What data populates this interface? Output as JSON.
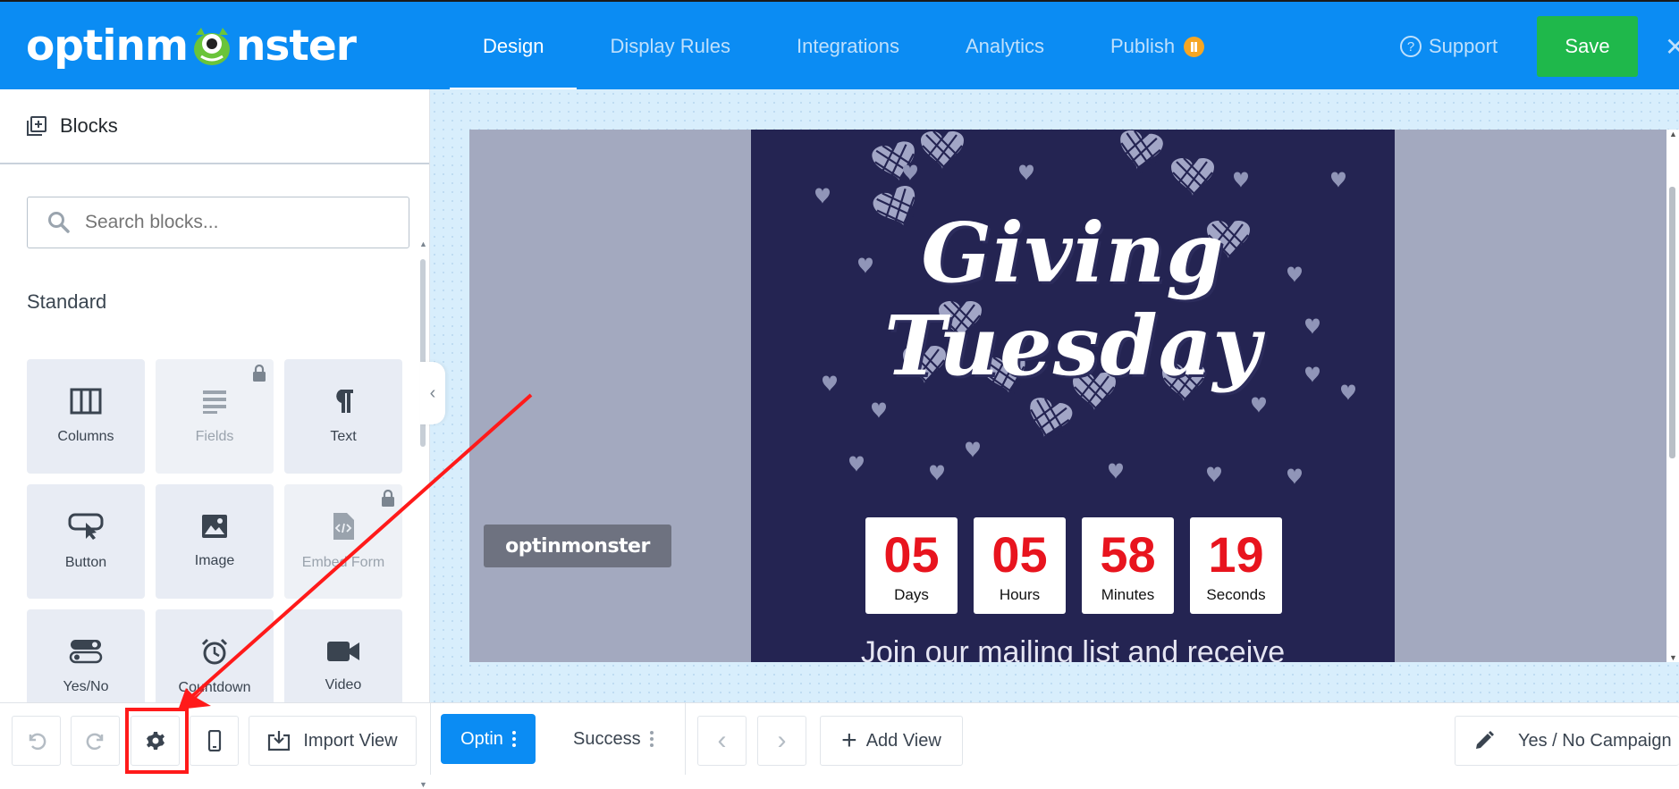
{
  "app": {
    "logo_text_left": "optinm",
    "logo_text_right": "nster"
  },
  "nav": {
    "items": [
      {
        "label": "Design",
        "active": true
      },
      {
        "label": "Display Rules",
        "active": false
      },
      {
        "label": "Integrations",
        "active": false
      },
      {
        "label": "Analytics",
        "active": false
      },
      {
        "label": "Publish",
        "active": false,
        "badge": "pause-icon"
      }
    ],
    "support_label": "Support",
    "save_label": "Save",
    "close_label": "✕"
  },
  "sidebar": {
    "header": "Blocks",
    "search_placeholder": "Search blocks...",
    "section_title": "Standard",
    "blocks": [
      {
        "label": "Columns",
        "icon": "columns-icon",
        "locked": false
      },
      {
        "label": "Fields",
        "icon": "fields-icon",
        "locked": true
      },
      {
        "label": "Text",
        "icon": "paragraph-icon",
        "locked": false
      },
      {
        "label": "Button",
        "icon": "button-cursor-icon",
        "locked": false
      },
      {
        "label": "Image",
        "icon": "image-icon",
        "locked": false
      },
      {
        "label": "Embed Form",
        "icon": "embed-code-icon",
        "locked": true
      },
      {
        "label": "Yes/No",
        "icon": "yes-no-icon",
        "locked": false
      },
      {
        "label": "Countdown",
        "icon": "alarm-clock-icon",
        "locked": false
      },
      {
        "label": "Video",
        "icon": "video-camera-icon",
        "locked": false
      }
    ]
  },
  "preview": {
    "headline_line1": "Giving",
    "headline_line2": "Tuesday",
    "countdown": [
      {
        "value": "05",
        "label": "Days"
      },
      {
        "value": "05",
        "label": "Hours"
      },
      {
        "value": "58",
        "label": "Minutes"
      },
      {
        "value": "19",
        "label": "Seconds"
      }
    ],
    "body_text": "Join our mailing list and receive",
    "badge_text": "optinmonster"
  },
  "bottombar": {
    "import_view_label": "Import View",
    "optin_label": "Optin",
    "success_label": "Success",
    "add_view_label": "Add View",
    "campaign_label": "Yes / No Campaign"
  },
  "colors": {
    "brand_blue": "#0b8cf3",
    "save_green": "#1fb84b",
    "popup_navy": "#242452",
    "countdown_red": "#e8141e",
    "annotation_red": "#ff1a1a"
  }
}
